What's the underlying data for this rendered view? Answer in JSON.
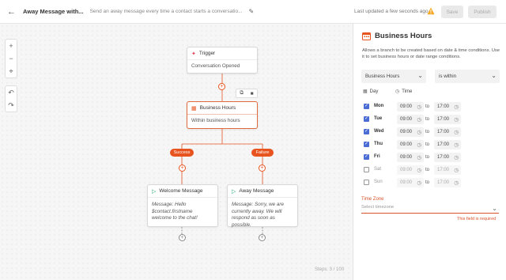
{
  "header": {
    "back_icon": "arrow-left-icon",
    "title": "Away Message with...",
    "subtitle": "Send an away message every time a contact starts a conversatio...",
    "updated": "Last updated a few seconds ago",
    "save_label": "Save",
    "publish_label": "Publish",
    "warning_color": "#f5a623"
  },
  "canvas": {
    "zoom_in": "+",
    "zoom_out": "−",
    "fit": "⌖",
    "undo": "↶",
    "redo": "↷",
    "steps": "Steps: 3 / 100"
  },
  "nodes": {
    "trigger": {
      "title": "Trigger",
      "body": "Conversation Opened"
    },
    "business": {
      "title": "Business Hours",
      "body": "Within business hours"
    },
    "success_label": "Success",
    "failure_label": "Failure",
    "welcome": {
      "title": "Welcome Message",
      "body": "Message: Hello $contact.firstname welcome to the chat!"
    },
    "away": {
      "title": "Away Message",
      "body": "Message: Sorry, we are currently away. We will respond as soon as possible."
    }
  },
  "panel": {
    "title": "Business Hours",
    "description": "Allows a branch to be created based on date & time conditions. Use it to set business hours or date range conditions.",
    "type_select": "Business Hours",
    "operator_select": "is within",
    "col_day": "Day",
    "col_time": "Time",
    "to_label": "to",
    "days": [
      {
        "name": "Mon",
        "checked": true,
        "from": "09:00",
        "to": "17:00"
      },
      {
        "name": "Tue",
        "checked": true,
        "from": "09:00",
        "to": "17:00"
      },
      {
        "name": "Wed",
        "checked": true,
        "from": "09:00",
        "to": "17:00"
      },
      {
        "name": "Thu",
        "checked": true,
        "from": "09:00",
        "to": "17:00"
      },
      {
        "name": "Fri",
        "checked": true,
        "from": "09:00",
        "to": "17:00"
      },
      {
        "name": "Sat",
        "checked": false,
        "from": "09:00",
        "to": "17:00"
      },
      {
        "name": "Sun",
        "checked": false,
        "from": "09:00",
        "to": "17:00"
      }
    ],
    "timezone_label": "Time Zone",
    "timezone_placeholder": "Select timezone",
    "timezone_error": "This field is required",
    "accent_color": "#e8541f"
  }
}
